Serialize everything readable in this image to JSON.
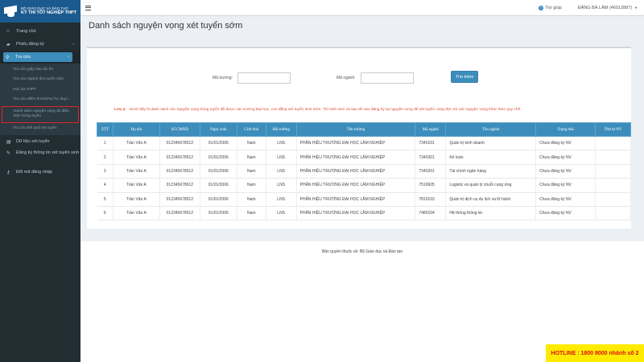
{
  "logo": {
    "line1": "BỘ GIÁO DỤC VÀ ĐÀO TẠO",
    "line2": "KỲ THI TỐT NGHIỆP THPT"
  },
  "sidebar": {
    "items": [
      {
        "icon": "home-icon",
        "label": "Trang chủ"
      },
      {
        "icon": "folder-icon",
        "label": "Phiếu đăng ký",
        "chevron": "‹"
      },
      {
        "icon": "search-icon",
        "label": "Tra cứu",
        "chevron": "‹"
      }
    ],
    "sub_items": [
      "Tra cứu giấy báo dự thi",
      "Tra cứu ngành đợt tuyển sinh",
      "Học bạ THPT",
      "Tra cứu điểm thi ĐGNL/Tư duy/...",
      "Danh sách nguyện vọng đủ điều kiện trúng tuyển",
      "Tra cứu kết quả xét tuyển"
    ],
    "bottom_items": [
      {
        "icon": "document-icon",
        "label": "Dữ liệu xét tuyển"
      },
      {
        "icon": "edit-icon",
        "label": "Đăng ký thông tin xét tuyển sinh"
      },
      {
        "icon": "key-icon",
        "label": "Đổi mã đăng nhập"
      }
    ]
  },
  "topbar": {
    "help": "Trợ giúp",
    "user": "ĐẶNG BÁ LÂM (46012887)"
  },
  "page_title": "Danh sách nguyện vọng xét tuyển sớm",
  "filters": {
    "school_label": "Mã trường:",
    "major_label": "Mã ngành:",
    "search_button": "Tìm kiếm"
  },
  "note": {
    "prefix": "Lưu ý:",
    "text": "Dưới đây là danh sách các nguyện vọng trúng tuyển đã được các trường Đại học, cao đẳng xét tuyển sinh sớm. Thí sinh xem và sau đó vào đăng ký lại nguyện vọng để xét tuyển cùng đợt với các nguyện vọng khác theo quy chế."
  },
  "table": {
    "headers": [
      "STT",
      "Họ tên",
      "Số CMND",
      "Ngày sinh",
      "Giới tính",
      "Mã trường",
      "Tên trường",
      "Mã ngành",
      "Tên ngành",
      "Trạng thái",
      "Thứ tự NV"
    ],
    "rows": [
      [
        "1",
        "Trần Văn A",
        "012345678912",
        "01/01/2006",
        "Nam",
        "LNS",
        "PHÂN HIỆU TRƯỜNG ĐẠI HỌC LÂM NGHIỆP",
        "7340101",
        "Quản trị kinh doanh",
        "Chưa đăng ký NV",
        ""
      ],
      [
        "2",
        "Trần Văn A",
        "012345678912",
        "01/01/2006",
        "Nam",
        "LNS",
        "PHÂN HIỆU TRƯỜNG ĐẠI HỌC LÂM NGHIỆP",
        "7340301",
        "Kế toán",
        "Chưa đăng ký NV",
        ""
      ],
      [
        "3",
        "Trần Văn A",
        "012345678912",
        "01/01/2006",
        "Nam",
        "LNS",
        "PHÂN HIỆU TRƯỜNG ĐẠI HỌC LÂM NGHIỆP",
        "7340201",
        "Tài chính ngân hàng",
        "Chưa đăng ký NV",
        ""
      ],
      [
        "4",
        "Trần Văn A",
        "012345678912",
        "01/01/2006",
        "Nam",
        "LNS",
        "PHÂN HIỆU TRƯỜNG ĐẠI HỌC LÂM NGHIỆP",
        "7510605",
        "Logistic và quản lý chuỗi cung ứng",
        "Chưa đăng ký NV",
        ""
      ],
      [
        "5",
        "Trần Văn A",
        "012345678912",
        "01/01/2006",
        "Nam",
        "LNS",
        "PHÂN HIỆU TRƯỜNG ĐẠI HỌC LÂM NGHIỆP",
        "7810103",
        "Quản trị dịch vụ du lịch và lữ hành",
        "Chưa đăng ký NV",
        ""
      ],
      [
        "6",
        "Trần Văn A",
        "012345678912",
        "01/01/2006",
        "Nam",
        "LNS",
        "PHÂN HIỆU TRƯỜNG ĐẠI HỌC LÂM NGHIỆP",
        "7480104",
        "Hệ thống thông tin",
        "Chưa đăng ký NV",
        ""
      ]
    ]
  },
  "footer": {
    "text": "Bản quyền thuộc về: Bộ Giáo dục và Đào tạo",
    "hotline": "HOTLINE : 1800 8000 nhánh số 2"
  },
  "colors": {
    "sidebar": "#222d32",
    "accent": "#3c8dbc",
    "highlight": "#e0232f",
    "hotline_bg": "#ffeb00"
  }
}
